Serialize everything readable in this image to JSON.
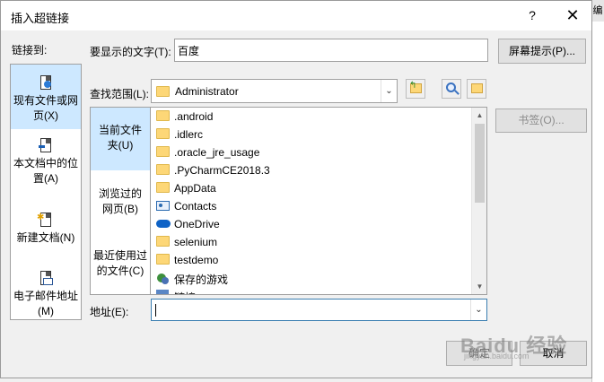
{
  "dialog": {
    "title": "插入超链接",
    "help": "?",
    "close": "✕"
  },
  "link_to": {
    "label": "链接到:",
    "items": [
      {
        "line1": "现有文件或网",
        "line2": "页(X)",
        "icon": "document-web-icon",
        "selected": true
      },
      {
        "line1": "本文档中的位",
        "line2": "置(A)",
        "icon": "document-place-icon",
        "selected": false
      },
      {
        "line1": "新建文档(N)",
        "line2": "",
        "icon": "new-document-icon",
        "selected": false
      },
      {
        "line1": "电子邮件地址",
        "line2": "(M)",
        "icon": "email-icon",
        "selected": false
      }
    ]
  },
  "text_to_display": {
    "label": "要显示的文字(T):",
    "value": "百度"
  },
  "screentip_button": "屏幕提示(P)...",
  "look_in": {
    "label": "查找范围(L):",
    "value": "Administrator"
  },
  "bookmark_button": "书签(O)...",
  "side_tabs": [
    {
      "line1": "当前文件",
      "line2": "夹(U)",
      "selected": true
    },
    {
      "line1": "浏览过的",
      "line2": "网页(B)",
      "selected": false
    },
    {
      "line1": "最近使用过",
      "line2": "的文件(C)",
      "selected": false
    }
  ],
  "files": [
    {
      "name": ".android",
      "icon": "folder-icon"
    },
    {
      "name": ".idlerc",
      "icon": "folder-icon"
    },
    {
      "name": ".oracle_jre_usage",
      "icon": "folder-icon"
    },
    {
      "name": ".PyCharmCE2018.3",
      "icon": "folder-icon"
    },
    {
      "name": "AppData",
      "icon": "folder-icon"
    },
    {
      "name": "Contacts",
      "icon": "contacts-icon"
    },
    {
      "name": "OneDrive",
      "icon": "onedrive-icon"
    },
    {
      "name": "selenium",
      "icon": "folder-icon"
    },
    {
      "name": "testdemo",
      "icon": "folder-icon"
    },
    {
      "name": "保存的游戏",
      "icon": "saved-games-icon"
    },
    {
      "name": "链接",
      "icon": "links-icon"
    }
  ],
  "address": {
    "label": "地址(E):",
    "value": ""
  },
  "ok_button": "确定",
  "cancel_button": "取消",
  "background_tab": "编",
  "watermark": {
    "text": "Baidu 经验",
    "sub": "jingyan.baidu.com"
  }
}
